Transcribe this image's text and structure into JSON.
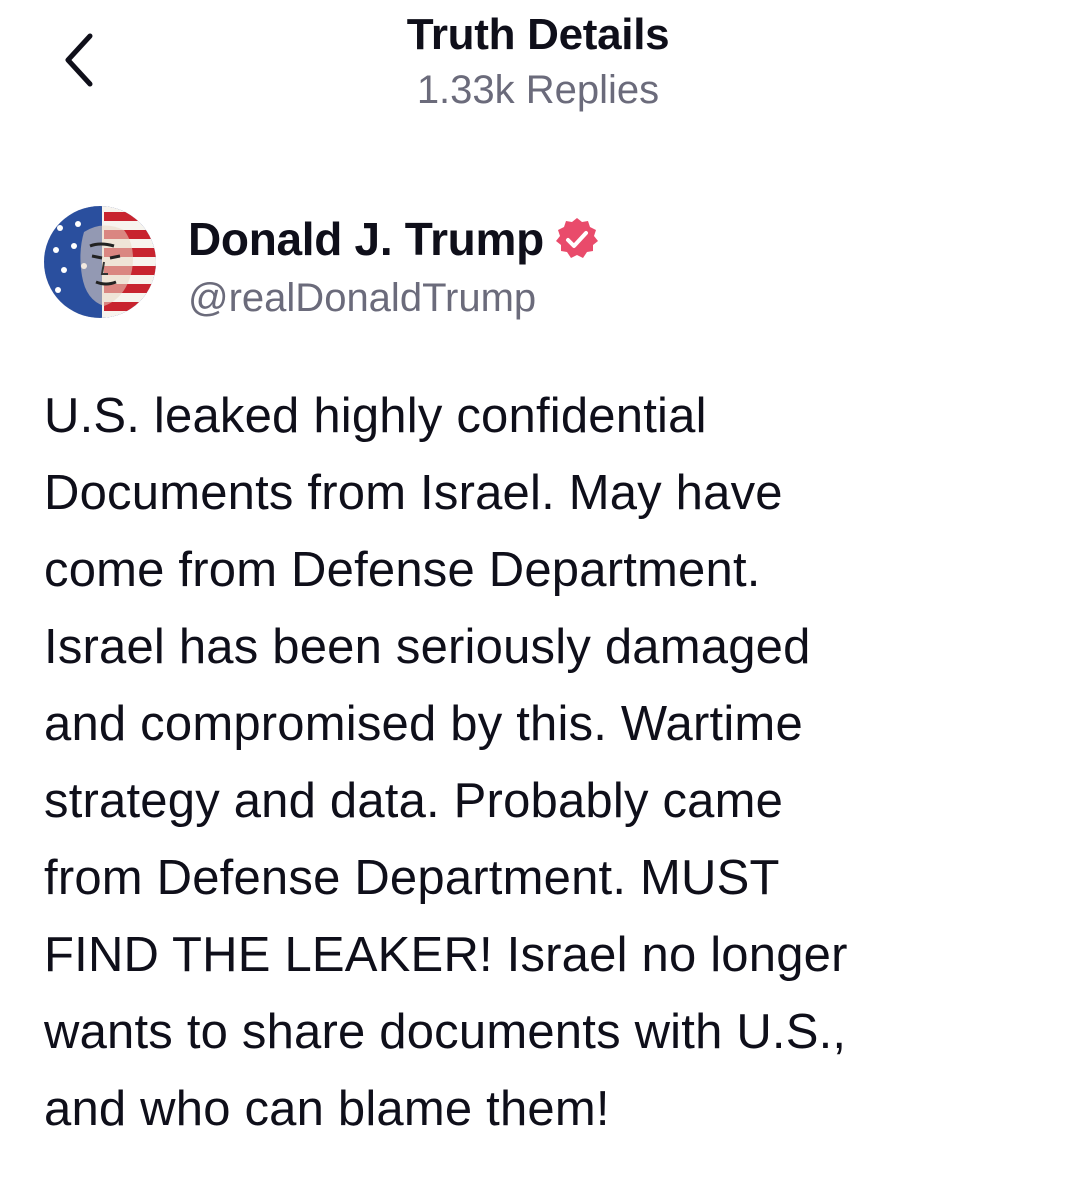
{
  "header": {
    "title": "Truth Details",
    "subtitle": "1.33k Replies"
  },
  "author": {
    "name": "Donald J. Trump",
    "handle": "@realDonaldTrump"
  },
  "colors": {
    "accent_verified": "#e94b6b",
    "text_primary": "#0f0f1a",
    "text_secondary": "#6b6b7b"
  },
  "icons": {
    "back": "chevron-left-icon",
    "verified": "verified-badge-icon"
  },
  "post": {
    "lines": [
      "U.S. leaked highly confidential",
      "Documents from Israel. May have",
      "come from Defense Department.",
      "Israel has been seriously damaged",
      "and compromised by this. Wartime",
      "strategy and data. Probably came",
      "from Defense Department. MUST",
      "FIND THE LEAKER! Israel no longer",
      "wants to share documents with U.S.,",
      "and who can blame them!"
    ]
  }
}
